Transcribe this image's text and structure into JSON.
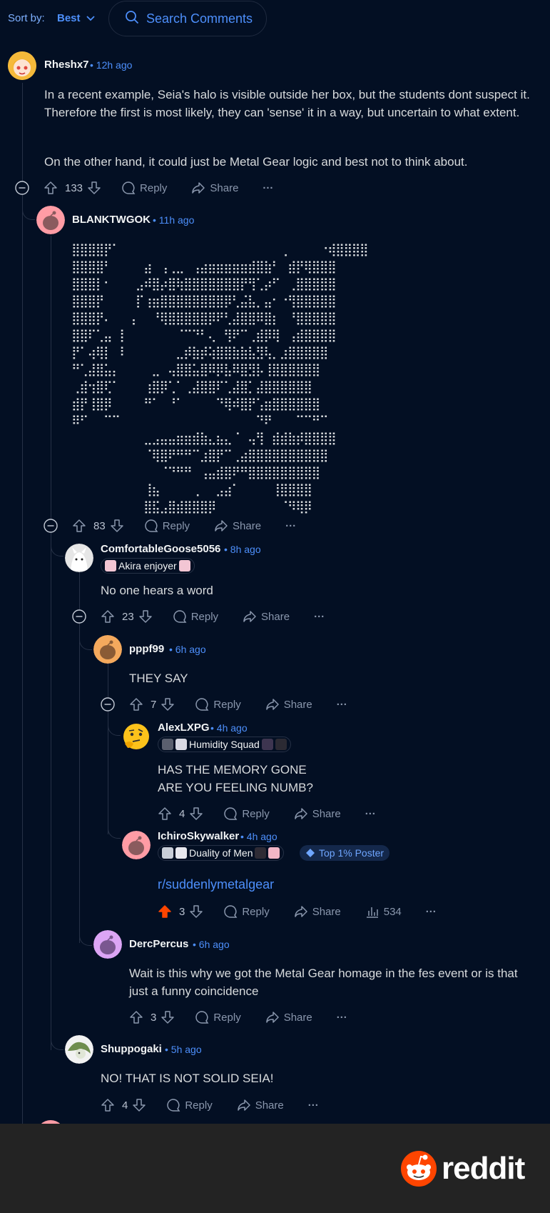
{
  "sort": {
    "label": "Sort by:",
    "value": "Best"
  },
  "search": {
    "placeholder": "Search Comments"
  },
  "actions": {
    "reply": "Reply",
    "share": "Share",
    "more": "···"
  },
  "comments": [
    {
      "user": "Rheshx7",
      "time": "• 12h ago",
      "paragraphs": [
        "In a recent example, Seia's halo is visible outside her box, but the students dont suspect it. Therefore the first is most likely, they can 'sense' it in a way, but uncertain to what extent.",
        "On the other hand, it could just be Metal Gear logic and best not to think about."
      ],
      "votes": "133"
    },
    {
      "user": "BLANKTWGOK",
      "time": "• 11h ago",
      "ascii_art": "⣿⣿⣿⣿⡟⠁⠀⠀⠀⠀⠀⠀⠀⠀⠀⠀⠀⠀⠀⠀⠀⠀⠀⠀⠀⠀⢀⠀⠀⠀⠀⠐⢾⣿⣿⣿⣿\n⣿⣿⣿⣿⠃⠀⠀⠀⠀⣴⠀⢠⢀⣀⠀⢠⣴⣶⣶⣶⣶⣶⣾⣿⣷⠃⠀⣾⡟⢿⣿⣿⣿\n⣿⣿⣿⡇⠂⠀⠀⠀⣠⠾⣿⡴⣿⢷⣿⣿⣿⣿⣿⣿⣿⡟⢻⢁⡴⠋⠀⢀⣿⣿⣿⣿⣿\n⣿⣿⣿⡟⠀⠀⠀⠀⡏⢰⣶⣿⣿⣿⣿⣿⣿⣿⣿⡿⢃⣬⣧⡀⣤⠂⠐⢻⣿⣿⣿⣿⣿\n⣿⣿⣿⡟⠄⠀⠀⢠⠀⠀⠘⢿⣿⣿⣿⣿⣿⡿⠟⢃⣼⣿⣿⠿⣿⡆⠀⠘⣿⣿⣿⣿⣿\n⣿⣿⠏⢁⣤⠀⡇⠀⠀⠀⠀⠀⠀⠈⠉⠙⠃⢄⠀⢻⠟⠉⢀⣾⡿⢿⠀⢠⣾⣿⣿⣿⣿\n⡟⠁⢴⢿⡇⠀⠇⠀⠀⠀⠀⠀⠀⣀⡾⣷⡾⢵⣿⣿⣷⣷⣧⣻⢧⡀⣰⣿⣿⣿⣿⣿\n⠛⢁⣼⣿⣥⡄⠀⠀⠀⠀⣀⠀⢤⣿⣿⣥⣿⠿⡿⣧⠿⣿⣻⡧⢸⣿⣿⣿⣿⣿⣿\n⢀⣾⢲⣿⢏⠁⠀⠀⠀⢰⣿⡿⢁⠁⢀⣼⣿⣿⠏⢁⣼⣿⡁⣼⣿⣿⣿⣿⣿⣿\n⣾⡟⢸⣿⡿⠀⠀⠀⠀⠛⠁⠀⠘⠁⠀⠀⠀⠀⠙⢿⠾⣿⡟⢡⣶⣿⣿⣿⣿⣿⣿\n⠿⠋⠀⠀⠉⠉⠀⠀⠀⠀⠀⠀⠀⠀⠀⠀⠀⠀⠀⠀⠀⠀⠀⠙⠟⠀⠀⠀⠉⠉⠛⠉\n⠀⠀⠀⠀⠀⠀⠀⠀⠀⣀⣠⣤⣤⣶⣶⣾⣷⣄⣦⣄⠈⠀⢤⢻⠀⣾⣾⣷⡾⣿⣿⣿⣿\n⠀⠀⠀⠀⠀⠀⠀⠀⠀⠈⢿⣿⠟⠛⠛⠉⣰⣿⡟⠉⢀⣴⣿⣿⣿⣿⣿⣿⣿⣿⣿⣿\n⠀⠀⠀⠀⠀⠀⠀⠀⠀⠀⠀⠈⠙⠛⠛⠀⢠⣤⣾⣿⠟⠛⣿⣿⣿⣿⣿⣿⣿⣿⣿\n⠀⠀⠀⠀⠀⠀⠀⠀⠀⢸⣦⠀⠀⠀⠀⢀⠀⠀⣠⣴⠁⠀⠀⠀⠀⢸⣿⣿⣿⣿\n⠀⠀⠀⠀⠀⠀⠀⠀⠀⣿⣯⣠⣿⣾⣿⣿⣿⡿⠀⠀⠀⠀⠀⠀⠀⠀⠈⠻⢿⡿",
      "votes": "83"
    },
    {
      "user": "ComfortableGoose5056",
      "time": "• 8h ago",
      "flair": "Akira enjoyer",
      "text": "No one hears a word",
      "votes": "23"
    },
    {
      "user": "pppf99",
      "time": "• 6h ago",
      "text": "THEY SAY",
      "votes": "7"
    },
    {
      "user": "AlexLXPG",
      "time": "• 4h ago",
      "flair": "Humidity Squad",
      "lines": [
        "HAS THE MEMORY GONE",
        "ARE YOU FEELING NUMB?"
      ],
      "votes": "4"
    },
    {
      "user": "IchiroSkywalker",
      "time": "• 4h ago",
      "flair": "Duality of Men",
      "badge": "Top 1% Poster",
      "link": "r/suddenlymetalgear",
      "votes": "3",
      "views": "534"
    },
    {
      "user": "DercPercus",
      "time": "• 6h ago",
      "text": "Wait is this why we got the Metal Gear homage in the fes event or is that just a funny coincidence",
      "votes": "3"
    },
    {
      "user": "Shuppogaki",
      "time": "• 5h ago",
      "text": "NO! THAT IS NOT SOLID SEIA!",
      "votes": "4"
    }
  ],
  "footer": {
    "brand": "reddit"
  },
  "colors": {
    "background": "#030f23",
    "accent": "#4d8ffb",
    "upvoted": "#ff4500"
  }
}
